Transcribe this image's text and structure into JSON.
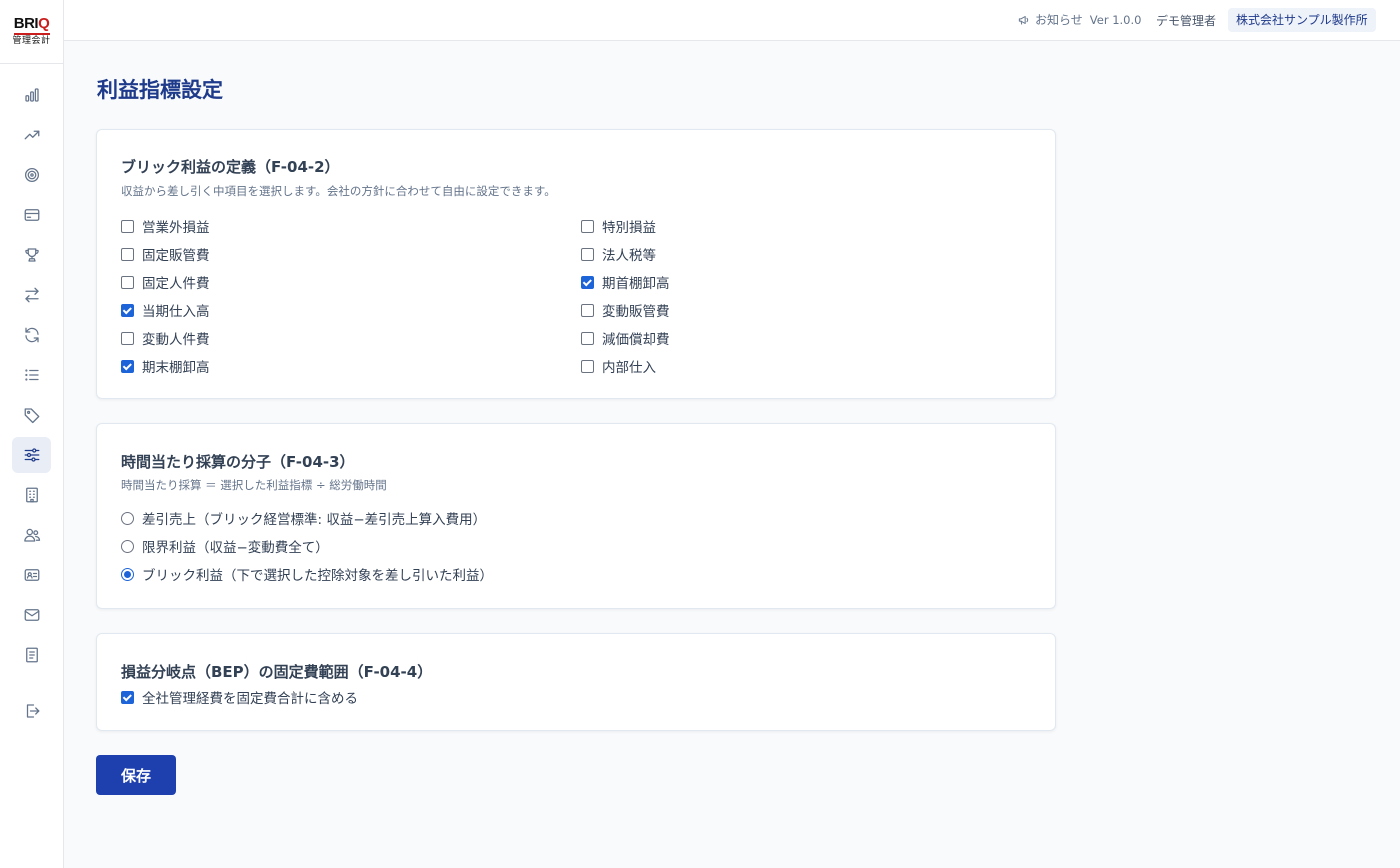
{
  "logo": {
    "mark_left": "BRI",
    "mark_right": "Q",
    "subtitle": "管理会計"
  },
  "sidebar": {
    "items": [
      {
        "name": "bar-chart-icon",
        "active": false
      },
      {
        "name": "trending-up-icon",
        "active": false
      },
      {
        "name": "target-icon",
        "active": false
      },
      {
        "name": "credit-card-icon",
        "active": false
      },
      {
        "name": "trophy-icon",
        "active": false
      },
      {
        "name": "arrows-left-right-icon",
        "active": false
      },
      {
        "name": "refresh-icon",
        "active": false
      },
      {
        "name": "list-icon",
        "active": false
      },
      {
        "name": "tag-icon",
        "active": false
      },
      {
        "name": "sliders-icon",
        "active": true
      },
      {
        "name": "building-icon",
        "active": false
      },
      {
        "name": "users-icon",
        "active": false
      },
      {
        "name": "id-card-icon",
        "active": false
      },
      {
        "name": "mail-icon",
        "active": false
      },
      {
        "name": "ledger-icon",
        "active": false
      },
      {
        "name": "logout-icon",
        "active": false
      }
    ]
  },
  "header": {
    "notice_label": "お知らせ",
    "version": "Ver 1.0.0",
    "user_name": "デモ管理者",
    "company_name": "株式会社サンプル製作所"
  },
  "page": {
    "title": "利益指標設定"
  },
  "section_profit_definition": {
    "title": "ブリック利益の定義（F-04-2）",
    "description": "収益から差し引く中項目を選択します。会社の方針に合わせて自由に設定できます。",
    "left_options": [
      {
        "label": "営業外損益",
        "checked": false
      },
      {
        "label": "固定販管費",
        "checked": false
      },
      {
        "label": "固定人件費",
        "checked": false
      },
      {
        "label": "当期仕入高",
        "checked": true
      },
      {
        "label": "変動人件費",
        "checked": false
      },
      {
        "label": "期末棚卸高",
        "checked": true
      }
    ],
    "right_options": [
      {
        "label": "特別損益",
        "checked": false
      },
      {
        "label": "法人税等",
        "checked": false
      },
      {
        "label": "期首棚卸高",
        "checked": true
      },
      {
        "label": "変動販管費",
        "checked": false
      },
      {
        "label": "減価償却費",
        "checked": false
      },
      {
        "label": "内部仕入",
        "checked": false
      }
    ]
  },
  "section_hourly": {
    "title": "時間当たり採算の分子（F-04-3）",
    "description": "時間当たり採算 ＝ 選択した利益指標 ÷ 総労働時間",
    "options": [
      {
        "label": "差引売上（ブリック経営標準: 収益−差引売上算入費用）",
        "checked": false
      },
      {
        "label": "限界利益（収益−変動費全て）",
        "checked": false
      },
      {
        "label": "ブリック利益（下で選択した控除対象を差し引いた利益）",
        "checked": true
      }
    ]
  },
  "section_bep": {
    "title": "損益分岐点（BEP）の固定費範囲（F-04-4）",
    "option": {
      "label": "全社管理経費を固定費合計に含める",
      "checked": true
    }
  },
  "save_button": {
    "label": "保存"
  },
  "colors": {
    "accent": "#1e40af",
    "title": "#1e3a8a",
    "check": "#1d64d8",
    "brand_red": "#c81e1e"
  }
}
